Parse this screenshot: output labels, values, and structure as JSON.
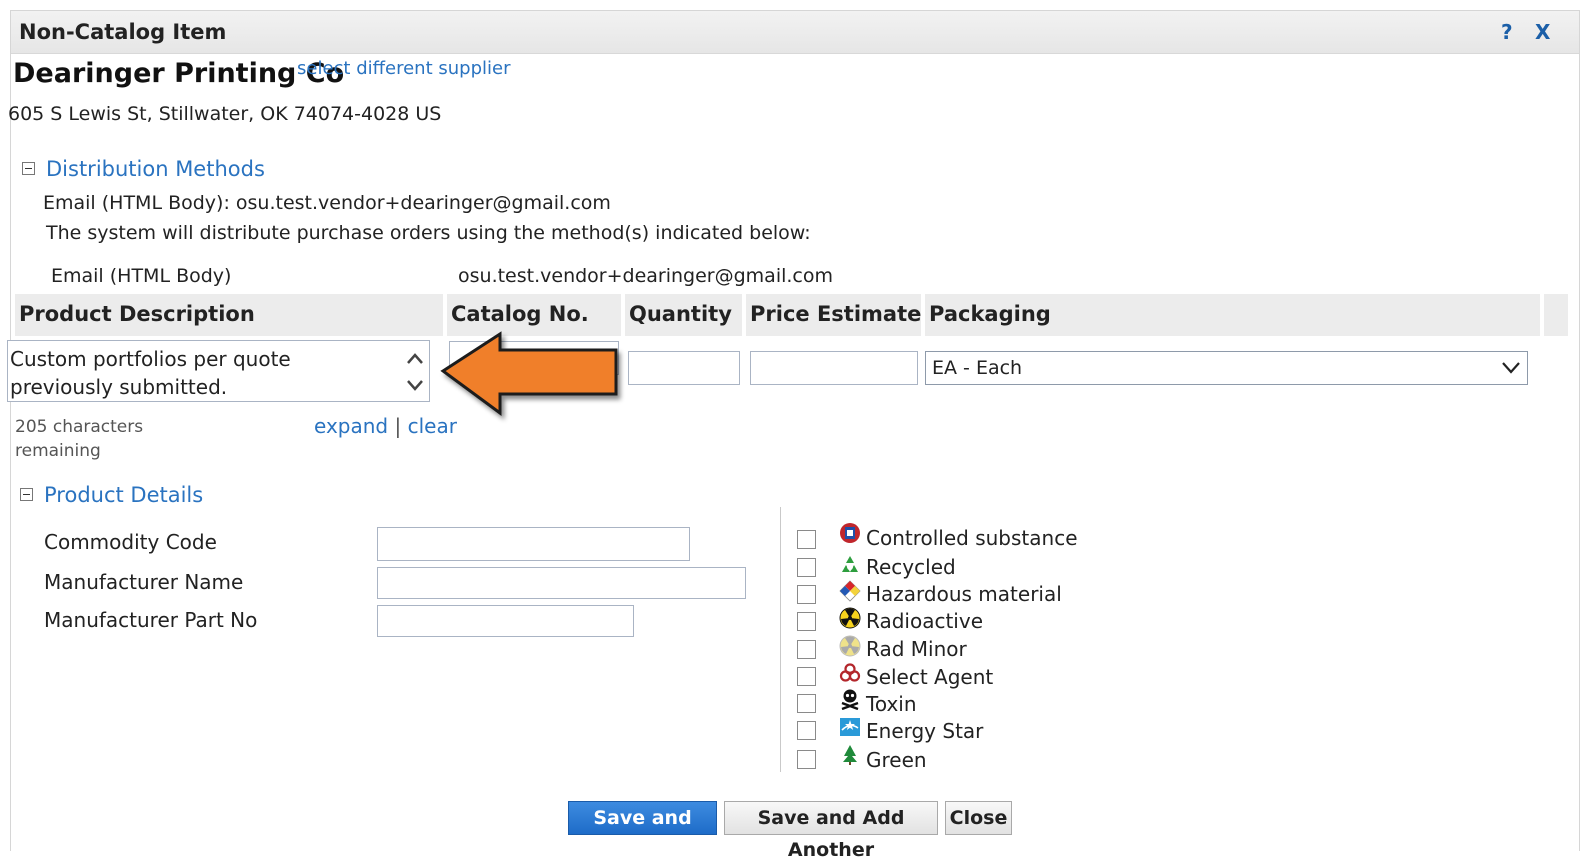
{
  "dialog": {
    "title": "Non-Catalog Item",
    "help_label": "?",
    "close_label": "X"
  },
  "supplier": {
    "name": "Dearinger Printing Co",
    "select_different_label": "select different supplier",
    "address": "605 S Lewis St, Stillwater, OK 74074-4028 US"
  },
  "distribution": {
    "section_label": "Distribution Methods",
    "email_line": "Email (HTML Body): osu.test.vendor+dearinger@gmail.com",
    "notice": "The system will distribute purchase orders using the method(s) indicated below:",
    "method_label": "Email (HTML Body)",
    "method_value": "osu.test.vendor+dearinger@gmail.com"
  },
  "item_table": {
    "headers": {
      "product_description": "Product Description",
      "catalog_no": "Catalog No.",
      "quantity": "Quantity",
      "price_estimate": "Price Estimate",
      "packaging": "Packaging"
    },
    "product_description_value": "Custom portfolios per quote previously submitted.",
    "characters_remaining": "205 characters remaining",
    "expand_label": "expand",
    "separator": "|",
    "clear_label": "clear",
    "catalog_no_value": "",
    "quantity_value": "",
    "price_estimate_value": "",
    "packaging_selected": "EA - Each"
  },
  "product_details": {
    "section_label": "Product Details",
    "fields": {
      "commodity_code_label": "Commodity Code",
      "manufacturer_name_label": "Manufacturer Name",
      "manufacturer_part_no_label": "Manufacturer Part No",
      "commodity_code_value": "",
      "manufacturer_name_value": "",
      "manufacturer_part_no_value": ""
    },
    "flags": [
      {
        "label": "Controlled substance",
        "icon": "controlled-substance-icon",
        "checked": false
      },
      {
        "label": "Recycled",
        "icon": "recycled-icon",
        "checked": false
      },
      {
        "label": "Hazardous material",
        "icon": "hazardous-material-icon",
        "checked": false
      },
      {
        "label": "Radioactive",
        "icon": "radioactive-icon",
        "checked": false
      },
      {
        "label": "Rad Minor",
        "icon": "rad-minor-icon",
        "checked": false
      },
      {
        "label": "Select Agent",
        "icon": "biohazard-icon",
        "checked": false
      },
      {
        "label": "Toxin",
        "icon": "skull-icon",
        "checked": false
      },
      {
        "label": "Energy Star",
        "icon": "energy-star-icon",
        "checked": false
      },
      {
        "label": "Green",
        "icon": "tree-icon",
        "checked": false
      }
    ]
  },
  "buttons": {
    "save_and_close": "Save and Close",
    "save_and_add_another": "Save and Add Another",
    "close": "Close"
  },
  "annotation": {
    "arrow_color": "#f07f2b",
    "arrow_icon": "left-arrow-icon"
  },
  "colors": {
    "link": "#2a73c0",
    "primary_button": "#1e6cc8"
  }
}
